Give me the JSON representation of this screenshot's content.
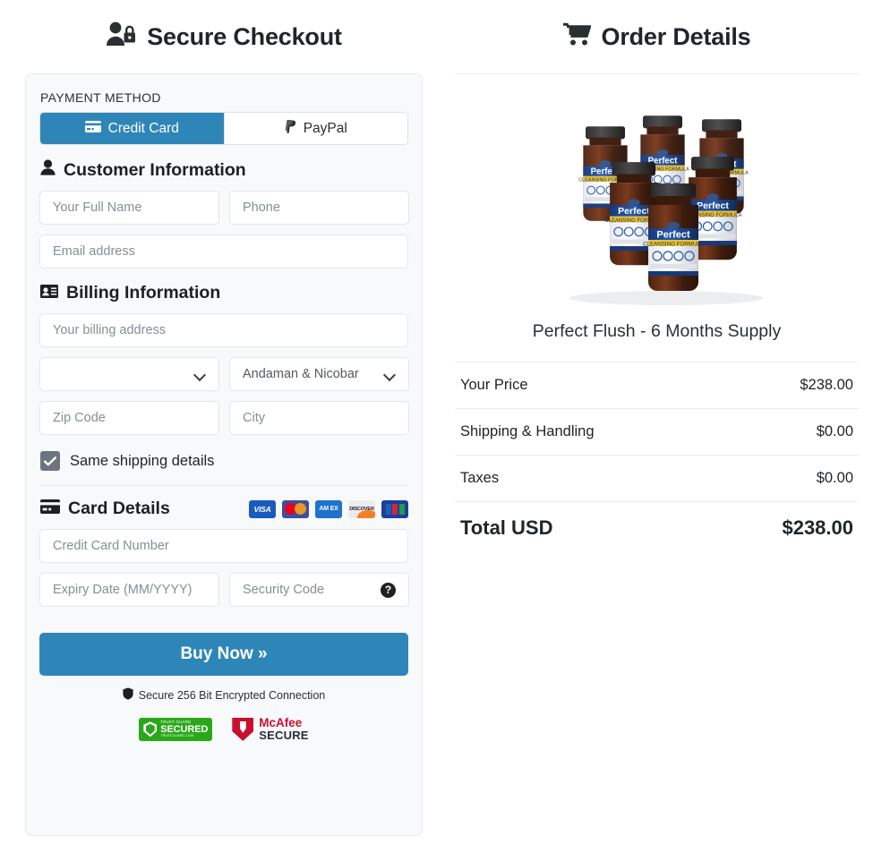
{
  "checkout": {
    "title": "Secure Checkout",
    "title_icon": "user-lock-icon",
    "payment_method_label": "PAYMENT METHOD",
    "tabs": [
      {
        "label": "Credit Card",
        "icon": "credit-card-icon",
        "active": true
      },
      {
        "label": "PayPal",
        "icon": "paypal-icon",
        "active": false
      }
    ],
    "customer_section": {
      "heading": "Customer Information",
      "icon": "user-icon",
      "fields": {
        "full_name": {
          "placeholder": "Your Full Name",
          "value": ""
        },
        "phone": {
          "placeholder": "Phone",
          "value": ""
        },
        "email": {
          "placeholder": "Email address",
          "value": ""
        }
      }
    },
    "billing_section": {
      "heading": "Billing Information",
      "icon": "id-card-icon",
      "fields": {
        "address": {
          "placeholder": "Your billing address",
          "value": ""
        },
        "country": {
          "value": "",
          "placeholder": ""
        },
        "state": {
          "value": "Andaman & Nicobar"
        },
        "zip": {
          "placeholder": "Zip Code",
          "value": ""
        },
        "city": {
          "placeholder": "City",
          "value": ""
        }
      },
      "same_shipping": {
        "label": "Same shipping details",
        "checked": true
      }
    },
    "card_section": {
      "heading": "Card Details",
      "icon": "credit-card-icon",
      "accepted_cards": [
        "VISA",
        "Mastercard",
        "AM EX",
        "DISCOVER",
        "JCB"
      ],
      "fields": {
        "number": {
          "placeholder": "Credit Card Number",
          "value": ""
        },
        "expiry": {
          "placeholder": "Expiry Date (MM/YYYY)",
          "value": ""
        },
        "cvv": {
          "placeholder": "Security Code",
          "value": "",
          "help_icon": "question-circle-icon"
        }
      }
    },
    "buy_button": "Buy Now »",
    "secure_note": "Secure 256 Bit Encrypted Connection",
    "secure_note_icon": "shield-icon",
    "trust_badges": [
      {
        "name": "trust-guard-secured",
        "top": "TRUST GUARD",
        "main": "SECURED",
        "bottom": "TRUSTGUARD.COM"
      },
      {
        "name": "mcafee-secure",
        "top": "McAfee",
        "main": "SECURE"
      }
    ]
  },
  "order": {
    "title": "Order Details",
    "title_icon": "shopping-cart-icon",
    "product_name": "Perfect Flush - 6 Months Supply",
    "product_image_alt": "six-bottles-perfect-flush",
    "summary": [
      {
        "label": "Your Price",
        "value": "$238.00"
      },
      {
        "label": "Shipping & Handling",
        "value": "$0.00"
      },
      {
        "label": "Taxes",
        "value": "$0.00"
      }
    ],
    "total": {
      "label": "Total USD",
      "value": "$238.00"
    }
  },
  "colors": {
    "accent": "#2e86b8",
    "panel_bg": "#f8f9fa",
    "border": "#e6e8ea",
    "checkbox": "#6c757d",
    "trust_green": "#2aa81a",
    "mcafee_red": "#c8102e"
  }
}
